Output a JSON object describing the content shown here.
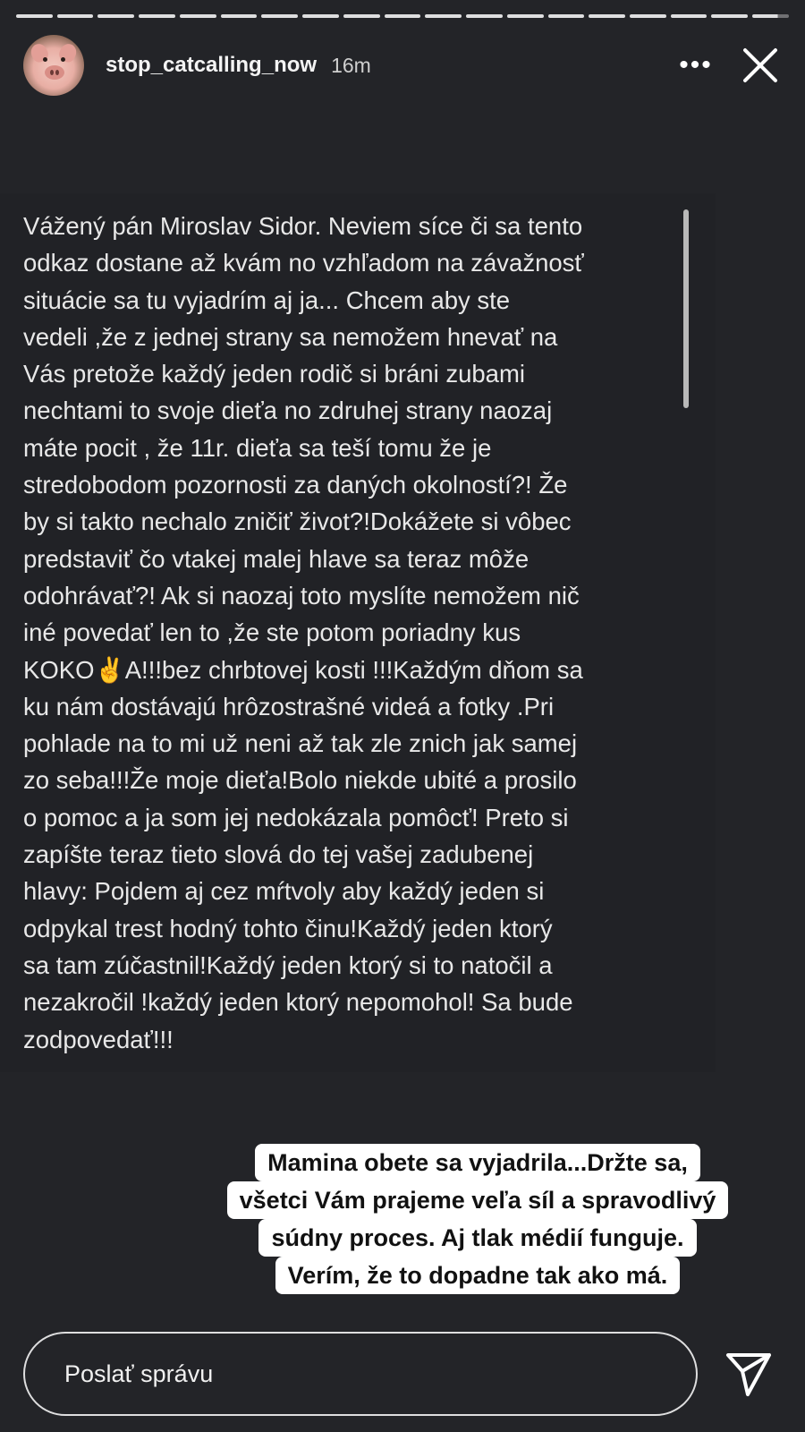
{
  "story": {
    "segments_total": 19,
    "segments_viewed": 18
  },
  "header": {
    "avatar_icon": "pig-avatar",
    "username": "stop_catcalling_now",
    "time": "16m",
    "more_icon": "more-icon",
    "close_icon": "close-icon"
  },
  "letter": {
    "lines": [
      "Vážený pán Miroslav Sidor. Neviem síce či sa tento",
      "odkaz dostane až kvám no vzhľadom na závažnosť",
      "situácie sa tu vyjadrím aj ja... Chcem aby ste",
      "vedeli ,že z jednej strany sa nemožem hnevať na",
      "Vás pretože každý jeden rodič si bráni zubami",
      "nechtami to svoje dieťa no zdruhej strany naozaj",
      "máte pocit , že 11r. dieťa sa teší tomu že je",
      "stredobodom pozornosti za daných okolností?! Že",
      "by si takto nechalo zničiť život?!Dokážete si vôbec",
      "predstaviť čo vtakej malej hlave sa teraz môže",
      "odohrávať?! Ak si naozaj toto myslíte nemožem nič",
      "iné povedať len to ,že ste potom poriadny kus",
      "KOKO✌️A!!!bez chrbtovej kosti !!!Každým dňom sa",
      "ku nám dostávajú hrôzostrašné videá a fotky .Pri",
      "pohlade na to mi už neni až tak zle znich jak samej",
      "zo seba!!!Že moje dieťa!Bolo niekde ubité a prosilo",
      "o pomoc a ja som jej nedokázala pomôcť! Preto si",
      "zapíšte teraz tieto slová do tej vašej zadubenej",
      "hlavy: Pojdem aj cez mŕtvoly aby každý jeden si",
      "odpykal trest hodný tohto činu!Každý jeden ktorý",
      "sa tam zúčastnil!Každý jeden ktorý si to natočil a",
      "nezakročil !každý jeden ktorý nepomohol! Sa bude",
      "zodpovedať!!!"
    ]
  },
  "caption": {
    "lines": [
      "Mamina obete sa vyjadrila...Držte sa,",
      "všetci Vám prajeme veľa síl a spravodlivý",
      "súdny proces. Aj tlak médií funguje.",
      "Verím, že to dopadne tak ako má."
    ]
  },
  "reply": {
    "placeholder": "Poslať správu",
    "send_icon": "send-icon"
  }
}
